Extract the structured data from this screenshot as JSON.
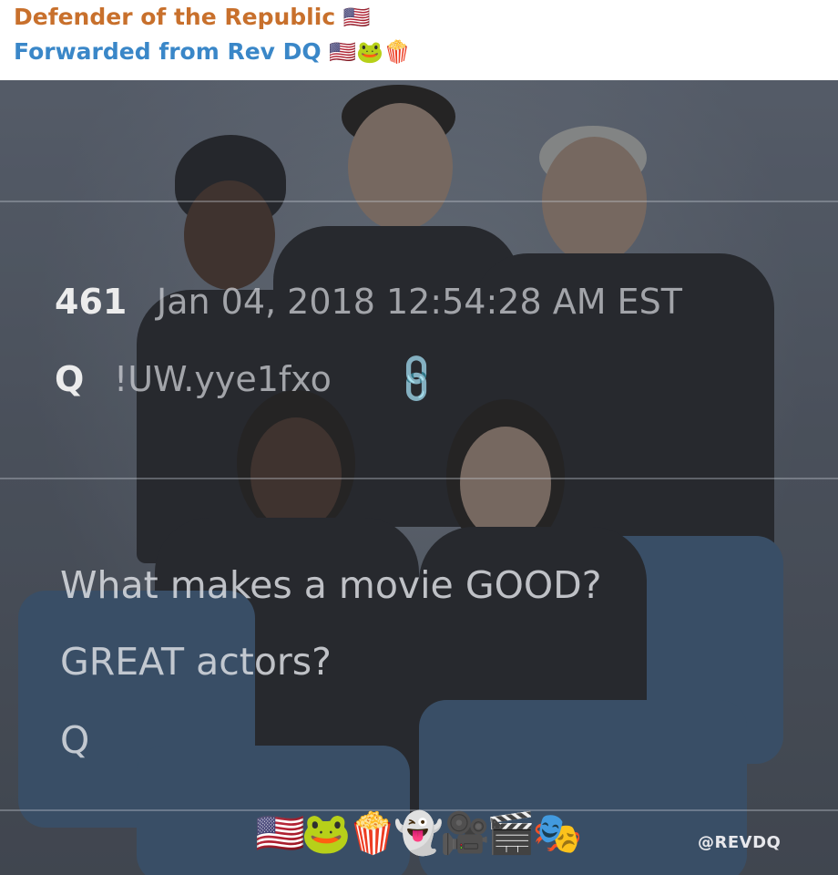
{
  "header": {
    "channel_name": "Defender of the Republic",
    "channel_emoji": "🇺🇸",
    "forwarded_label": "Forwarded from Rev DQ",
    "forwarded_emoji": "🇺🇸🐸🍿"
  },
  "post": {
    "number": "461",
    "date": "Jan 04, 2018 12:54:28 AM EST",
    "author": "Q",
    "tripcode": "!UW.yye1fxo",
    "link_icon": "🔗",
    "lines": [
      "What makes a movie GOOD?",
      "GREAT actors?",
      "Q"
    ]
  },
  "media": {
    "emoji_strip": "🇺🇸🐸🍿👻🎥🎬🎭",
    "watermark": "@REVDQ"
  }
}
